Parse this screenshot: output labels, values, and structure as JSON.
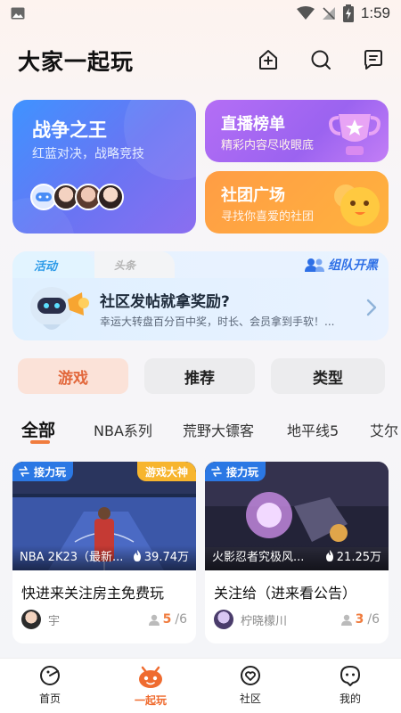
{
  "status_bar": {
    "time": "1:59"
  },
  "header": {
    "title": "大家一起玩"
  },
  "cards": {
    "war": {
      "title": "战争之王",
      "subtitle": "红蓝对决，战略竞技"
    },
    "live": {
      "title": "直播榜单",
      "subtitle": "精彩内容尽收眼底"
    },
    "club": {
      "title": "社团广场",
      "subtitle": "寻找你喜爱的社团"
    }
  },
  "banner": {
    "tab_active": "活动",
    "tab_inactive": "头条",
    "team_up": "组队开黑",
    "title": "社区发帖就拿奖励?",
    "subtitle": "幸运大转盘百分百中奖，时长、会员拿到手软！..."
  },
  "segments": {
    "game": "游戏",
    "recommend": "推荐",
    "type": "类型"
  },
  "categories": [
    "全部",
    "NBA系列",
    "荒野大镖客",
    "地平线5",
    "艾尔"
  ],
  "games": [
    {
      "relay": "接力玩",
      "badge": "游戏大神",
      "name": "NBA 2K23（最新...",
      "heat": "39.74万",
      "title": "快进来关注房主免费玩",
      "user": "宇",
      "count_current": "5",
      "count_total": "/6"
    },
    {
      "relay": "接力玩",
      "badge": "",
      "name": "火影忍者究极风...",
      "heat": "21.25万",
      "title": "关注给（进来看公告）",
      "user": "柠晓檬川",
      "count_current": "3",
      "count_total": "/6"
    }
  ],
  "bottom_nav": [
    {
      "label": "首页",
      "icon": "home-icon"
    },
    {
      "label": "一起玩",
      "icon": "play-together-icon"
    },
    {
      "label": "社区",
      "icon": "community-icon"
    },
    {
      "label": "我的",
      "icon": "profile-icon"
    }
  ],
  "colors": {
    "accent": "#ef6b2f",
    "relay_blue": "#2b78e4",
    "god_badge": "#f7b52e"
  }
}
